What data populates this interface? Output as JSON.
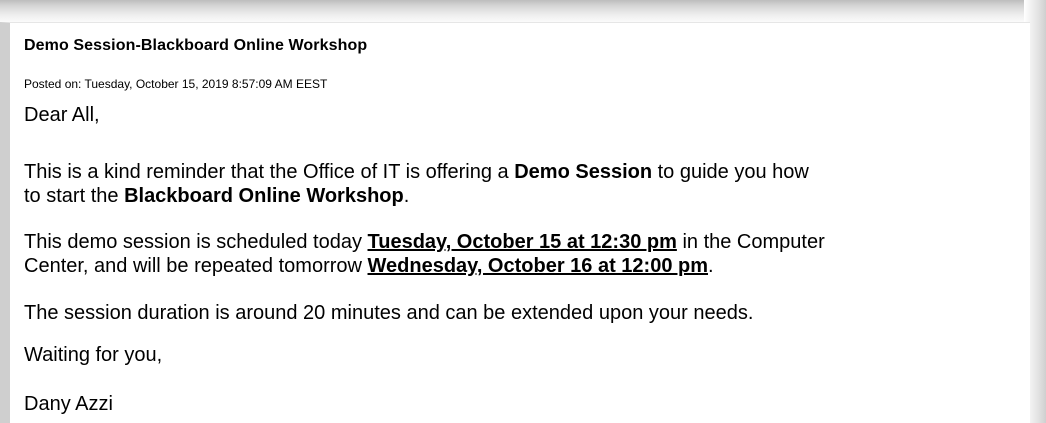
{
  "post": {
    "title": "Demo Session-Blackboard Online Workshop",
    "posted": "Posted on: Tuesday, October 15, 2019 8:57:09 AM EEST",
    "greeting": "Dear All,",
    "para1": {
      "line1_a": "This is a kind reminder that the Office of IT is offering a ",
      "line1_b": "Demo Session",
      "line1_c": " to guide you how",
      "line2_a": "to start the ",
      "line2_b": "Blackboard Online Workshop",
      "line2_c": "."
    },
    "para2": {
      "line1_a": "This demo session is scheduled today ",
      "line1_b": "Tuesday, October 15 at 12:30 pm",
      "line1_c": " in the Computer",
      "line2_a": "Center, and will be repeated tomorrow ",
      "line2_b": "Wednesday, October 16 at 12:00 pm",
      "line2_c": "."
    },
    "para3": "The session duration is around 20 minutes and can be extended upon your needs.",
    "closing": "Waiting for you,",
    "signature": "Dany Azzi"
  }
}
